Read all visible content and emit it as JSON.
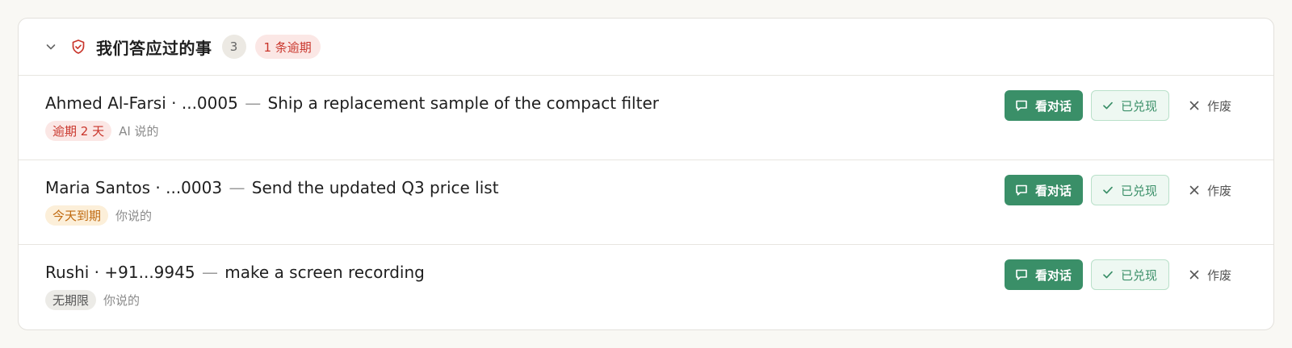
{
  "section": {
    "title": "我们答应过的事",
    "count": "3",
    "overdue_label": "1 条逾期",
    "icons": {
      "collapse": "chevron-down-icon",
      "status": "shield-check-icon"
    }
  },
  "colors": {
    "accent_green": "#3a8f68",
    "overdue_red": "#c9352b",
    "due_today_amber": "#c06a10"
  },
  "commitments": [
    {
      "contact": "Ahmed Al-Farsi · ...0005",
      "separator": "—",
      "task": "Ship a replacement sample of the compact filter",
      "due_label": "逾期 2 天",
      "due_status": "red",
      "source": "AI 说的",
      "actions": {
        "view": "看对话",
        "done": "已兑现",
        "void": "作废"
      }
    },
    {
      "contact": "Maria Santos · ...0003",
      "separator": "—",
      "task": "Send the updated Q3 price list",
      "due_label": "今天到期",
      "due_status": "amber",
      "source": "你说的",
      "actions": {
        "view": "看对话",
        "done": "已兑现",
        "void": "作废"
      }
    },
    {
      "contact": "Rushi · +91...9945",
      "separator": "—",
      "task": "make a screen recording",
      "due_label": "无期限",
      "due_status": "gray",
      "source": "你说的",
      "actions": {
        "view": "看对话",
        "done": "已兑现",
        "void": "作废"
      }
    }
  ]
}
